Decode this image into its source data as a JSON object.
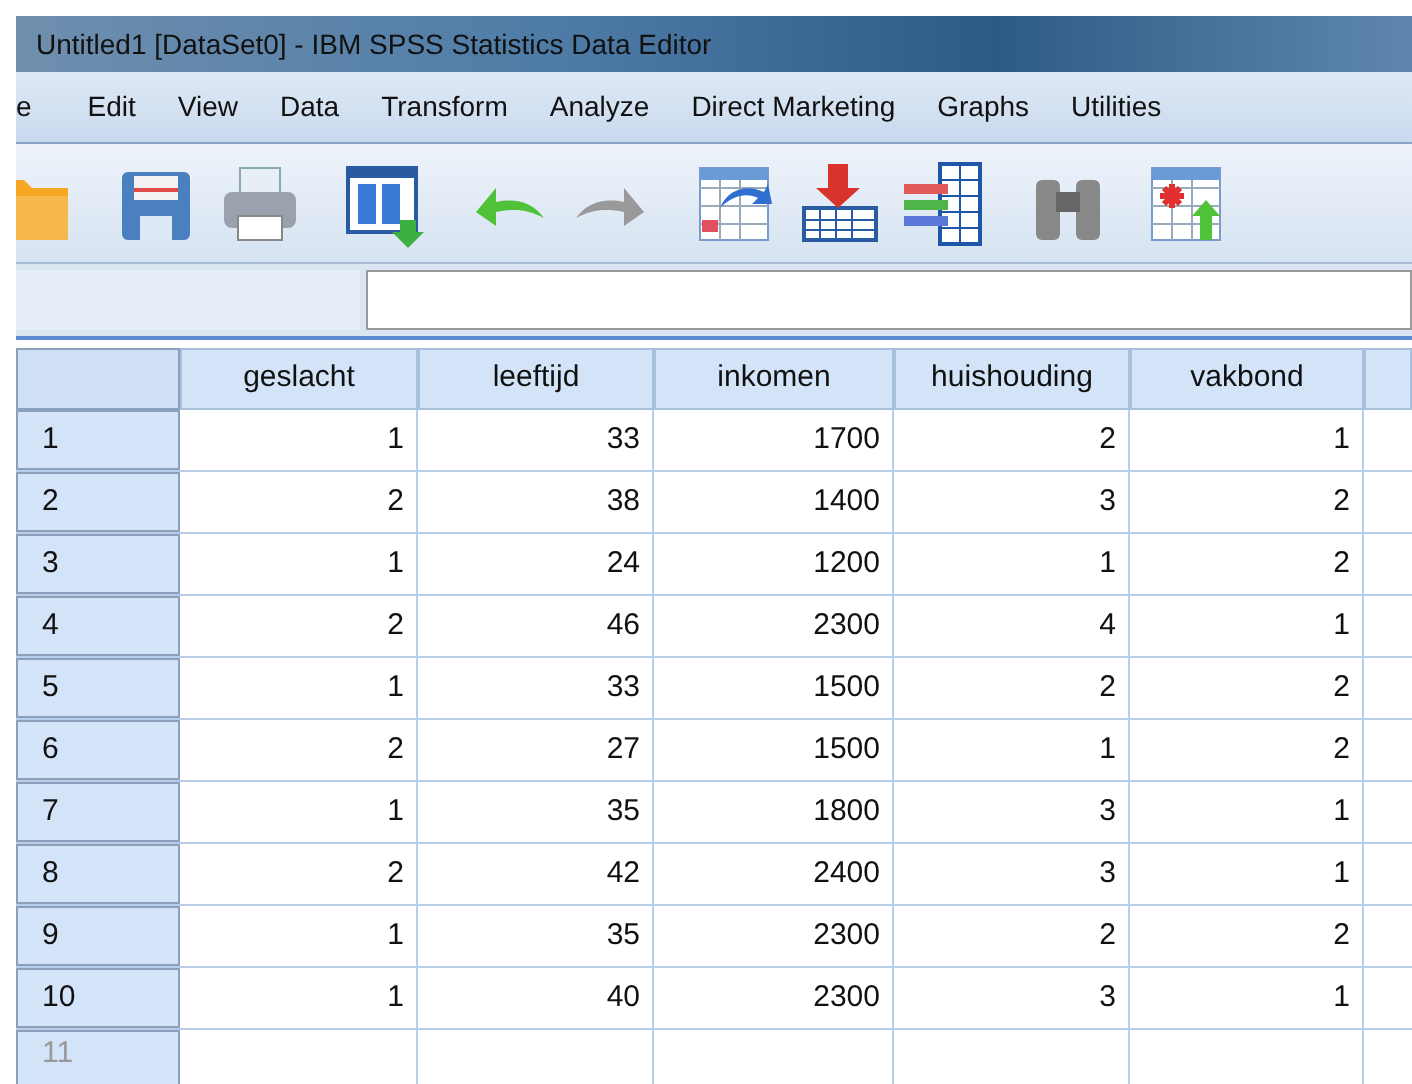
{
  "window": {
    "title": "Untitled1 [DataSet0] - IBM SPSS Statistics Data Editor"
  },
  "menu": [
    "e",
    "Edit",
    "View",
    "Data",
    "Transform",
    "Analyze",
    "Direct Marketing",
    "Graphs",
    "Utilities"
  ],
  "table": {
    "columns": [
      "geslacht",
      "leeftijd",
      "inkomen",
      "huishouding",
      "vakbond"
    ],
    "rows": [
      {
        "label": "1",
        "kind": "data",
        "cells": [
          "1",
          "33",
          "1700",
          "2",
          "1"
        ]
      },
      {
        "label": "2",
        "kind": "data",
        "cells": [
          "2",
          "38",
          "1400",
          "3",
          "2"
        ]
      },
      {
        "label": "3",
        "kind": "data",
        "cells": [
          "1",
          "24",
          "1200",
          "1",
          "2"
        ]
      },
      {
        "label": "4",
        "kind": "data",
        "cells": [
          "2",
          "46",
          "2300",
          "4",
          "1"
        ]
      },
      {
        "label": "5",
        "kind": "data",
        "cells": [
          "1",
          "33",
          "1500",
          "2",
          "2"
        ]
      },
      {
        "label": "6",
        "kind": "data",
        "cells": [
          "2",
          "27",
          "1500",
          "1",
          "2"
        ]
      },
      {
        "label": "7",
        "kind": "data",
        "cells": [
          "1",
          "35",
          "1800",
          "3",
          "1"
        ]
      },
      {
        "label": "8",
        "kind": "data",
        "cells": [
          "2",
          "42",
          "2400",
          "3",
          "1"
        ]
      },
      {
        "label": "9",
        "kind": "data",
        "cells": [
          "1",
          "35",
          "2300",
          "2",
          "2"
        ]
      },
      {
        "label": "10",
        "kind": "data",
        "cells": [
          "1",
          "40",
          "2300",
          "3",
          "1"
        ]
      },
      {
        "label": "11",
        "kind": "empty",
        "cells": []
      }
    ]
  }
}
